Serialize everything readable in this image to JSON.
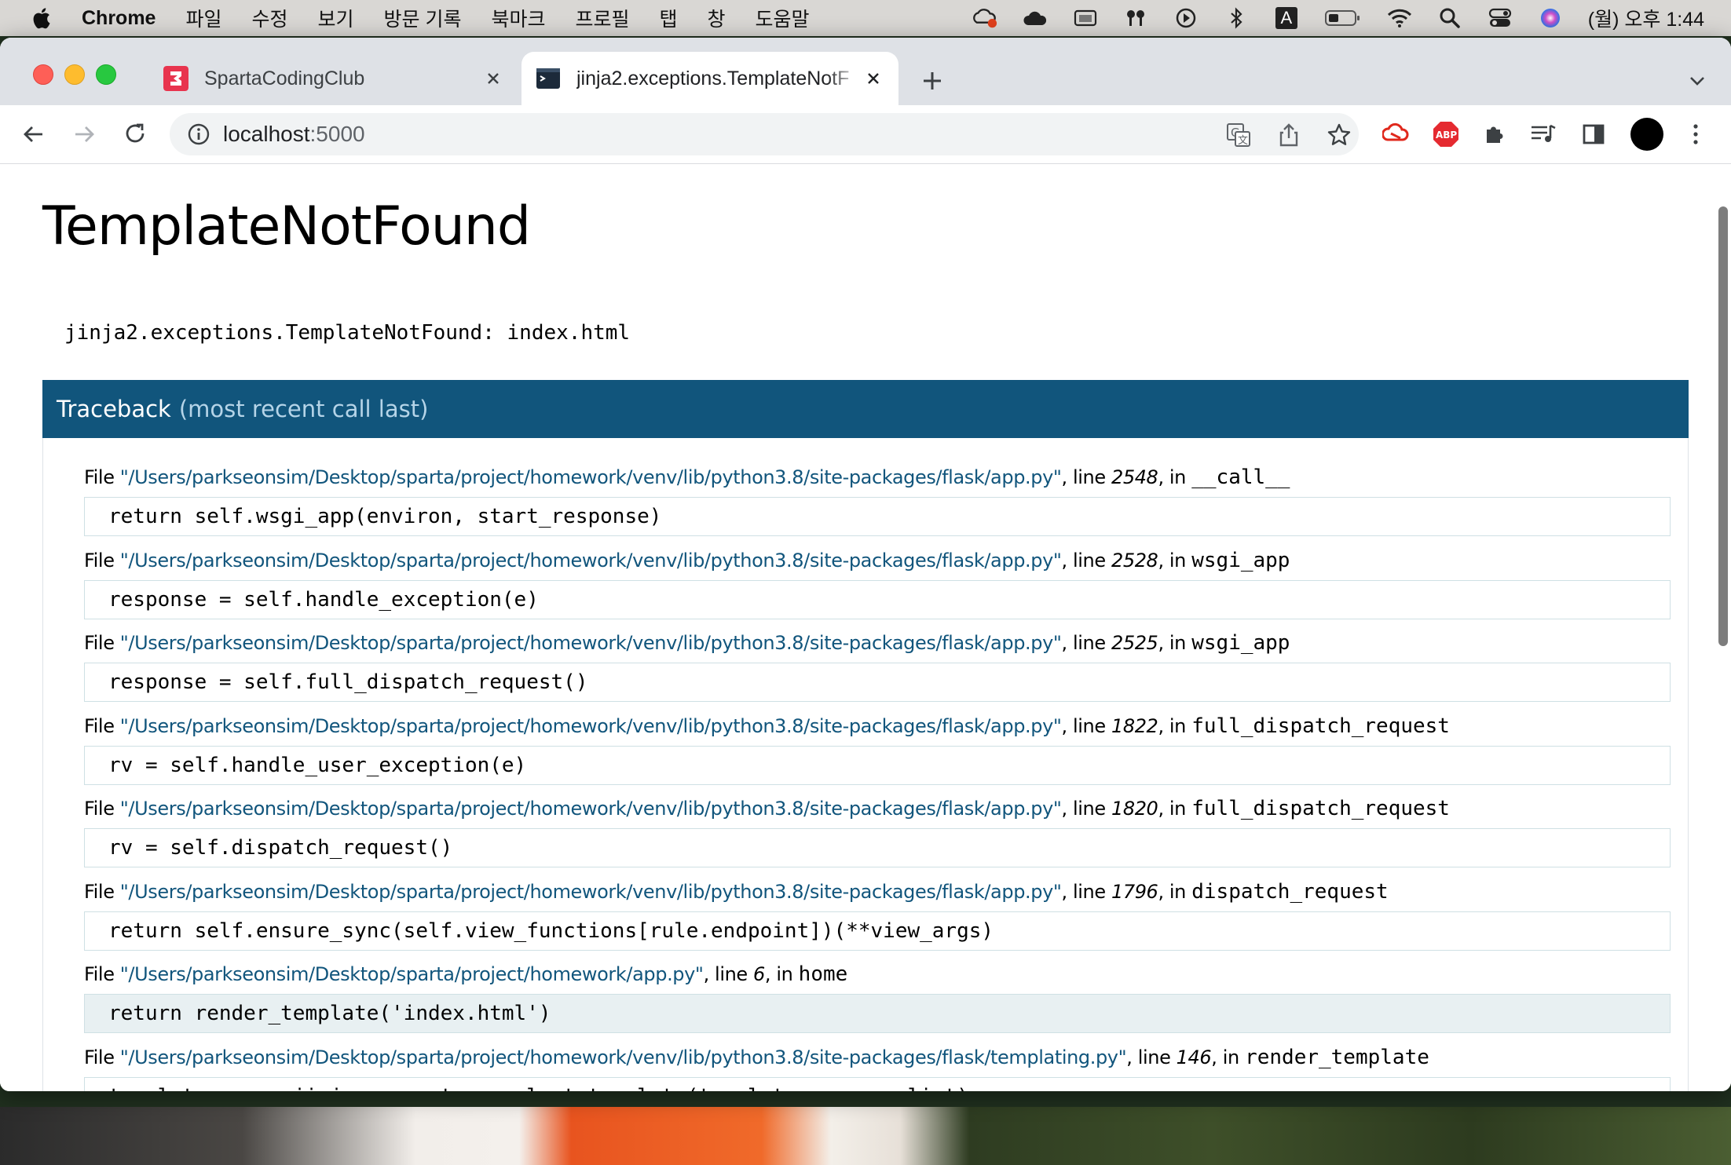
{
  "menubar": {
    "app_name": "Chrome",
    "items": [
      "파일",
      "수정",
      "보기",
      "방문 기록",
      "북마크",
      "프로필",
      "탭",
      "창",
      "도움말"
    ],
    "clock": "(월) 오후 1:44",
    "input_source": "A"
  },
  "tabs": [
    {
      "title": "SpartaCodingClub",
      "active": false
    },
    {
      "title": "jinja2.exceptions.TemplateNotF",
      "active": true
    }
  ],
  "omnibox": {
    "host": "localhost",
    "port": ":5000"
  },
  "extensions": {
    "abp_label": "ABP"
  },
  "page": {
    "title": "TemplateNotFound",
    "error_message": "jinja2.exceptions.TemplateNotFound: index.html",
    "traceback_label": "Traceback",
    "traceback_sub": "(most recent call last)",
    "file_prefix": "File",
    "line_prefix": "line",
    "in_prefix": "in",
    "frames": [
      {
        "filename": "\"/Users/parkseonsim/Desktop/sparta/project/homework/venv/lib/python3.8/site-packages/flask/app.py\"",
        "line": "2548",
        "func": "__call__",
        "code": "return self.wsgi_app(environ, start_response)",
        "highlight": false
      },
      {
        "filename": "\"/Users/parkseonsim/Desktop/sparta/project/homework/venv/lib/python3.8/site-packages/flask/app.py\"",
        "line": "2528",
        "func": "wsgi_app",
        "code": "response = self.handle_exception(e)",
        "highlight": false
      },
      {
        "filename": "\"/Users/parkseonsim/Desktop/sparta/project/homework/venv/lib/python3.8/site-packages/flask/app.py\"",
        "line": "2525",
        "func": "wsgi_app",
        "code": "response = self.full_dispatch_request()",
        "highlight": false
      },
      {
        "filename": "\"/Users/parkseonsim/Desktop/sparta/project/homework/venv/lib/python3.8/site-packages/flask/app.py\"",
        "line": "1822",
        "func": "full_dispatch_request",
        "code": "rv = self.handle_user_exception(e)",
        "highlight": false
      },
      {
        "filename": "\"/Users/parkseonsim/Desktop/sparta/project/homework/venv/lib/python3.8/site-packages/flask/app.py\"",
        "line": "1820",
        "func": "full_dispatch_request",
        "code": "rv = self.dispatch_request()",
        "highlight": false
      },
      {
        "filename": "\"/Users/parkseonsim/Desktop/sparta/project/homework/venv/lib/python3.8/site-packages/flask/app.py\"",
        "line": "1796",
        "func": "dispatch_request",
        "code": "return self.ensure_sync(self.view_functions[rule.endpoint])(**view_args)",
        "highlight": false
      },
      {
        "filename": "\"/Users/parkseonsim/Desktop/sparta/project/homework/app.py\"",
        "line": "6",
        "func": "home",
        "code": "return render_template('index.html')",
        "highlight": true
      },
      {
        "filename": "\"/Users/parkseonsim/Desktop/sparta/project/homework/venv/lib/python3.8/site-packages/flask/templating.py\"",
        "line": "146",
        "func": "render_template",
        "code": "template = app.jinja_env.get_or_select_template(template_name_or_list)",
        "highlight": false
      }
    ]
  },
  "colors": {
    "traceback_header": "#11557c",
    "filename": "#11557c",
    "code_highlight": "#e8f0f2"
  }
}
